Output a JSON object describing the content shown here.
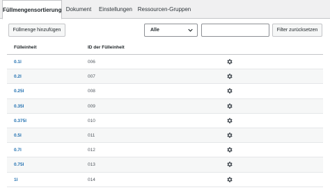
{
  "tabs": [
    {
      "label": "Füllmengensortierung",
      "active": true
    },
    {
      "label": "Dokument",
      "active": false
    },
    {
      "label": "Einstellungen",
      "active": false
    },
    {
      "label": "Ressourcen-Gruppen",
      "active": false
    }
  ],
  "toolbar": {
    "add_label": "Füllmenge hinzufügen",
    "filter_select_value": "Alle",
    "filter_input_value": "",
    "reset_label": "Filter zurücksetzen"
  },
  "table": {
    "headers": [
      "Fülleinheit",
      "ID der Fülleinheit"
    ],
    "rows": [
      {
        "unit": "0.1l",
        "id": "006"
      },
      {
        "unit": "0.2l",
        "id": "007"
      },
      {
        "unit": "0.25l",
        "id": "008"
      },
      {
        "unit": "0.35l",
        "id": "009"
      },
      {
        "unit": "0.375l",
        "id": "010"
      },
      {
        "unit": "0.5l",
        "id": "011"
      },
      {
        "unit": "0.7l",
        "id": "012"
      },
      {
        "unit": "0.75l",
        "id": "013"
      },
      {
        "unit": "1l",
        "id": "014"
      }
    ]
  },
  "colors": {
    "link": "#2271b1",
    "border": "#c3c4c7",
    "row_alt": "#f6f7f7"
  },
  "icons": {
    "row_action": "gear-icon",
    "select_arrow": "chevron-down-icon"
  }
}
